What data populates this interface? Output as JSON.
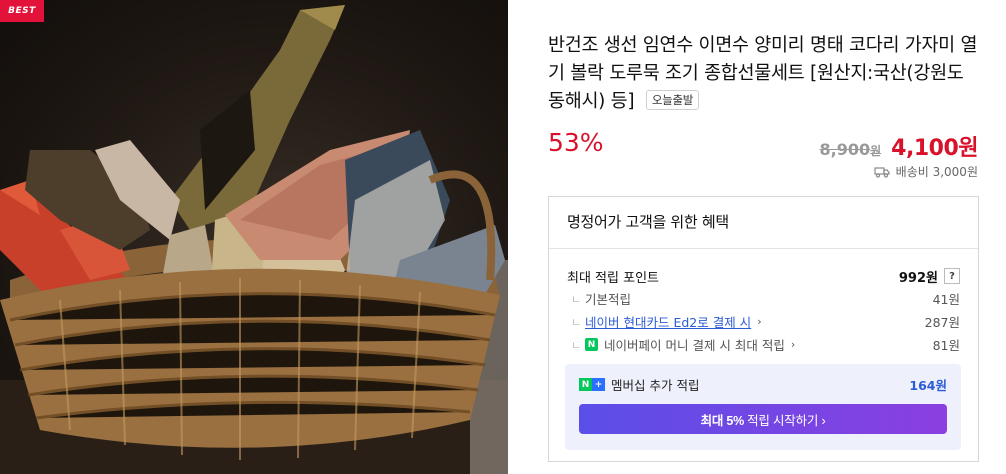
{
  "image": {
    "badge": "BEST"
  },
  "product": {
    "title": "반건조 생선 임연수 이면수 양미리 명태 코다리 가자미 열기 볼락 도루묵 조기 종합선물세트 [원산지:국산(강원도 동해시) 등]",
    "tag": "오늘출발",
    "discount": "53%",
    "original_price": "8,900",
    "original_price_unit": "원",
    "sale_price": "4,100원",
    "shipping": "배송비 3,000원"
  },
  "benefits": {
    "heading": "명정어가 고객을 위한 혜택",
    "max_label": "최대 적립 포인트",
    "max_value": "992원",
    "help": "?",
    "rows": [
      {
        "label": "기본적립",
        "value": "41원"
      },
      {
        "label": "네이버 현대카드 Ed2로 결제 시",
        "value": "287원"
      },
      {
        "label": "네이버페이 머니 결제 시 최대 적립",
        "value": "81원"
      }
    ],
    "membership_label": "멤버십 추가 적립",
    "membership_value": "164원",
    "cta_bold": "최대 5%",
    "cta_rest": "적립 시작하기 ›"
  },
  "colors": {
    "accent_red": "#d9122b",
    "link_blue": "#2c5bd6",
    "naver_green": "#03c75a"
  }
}
